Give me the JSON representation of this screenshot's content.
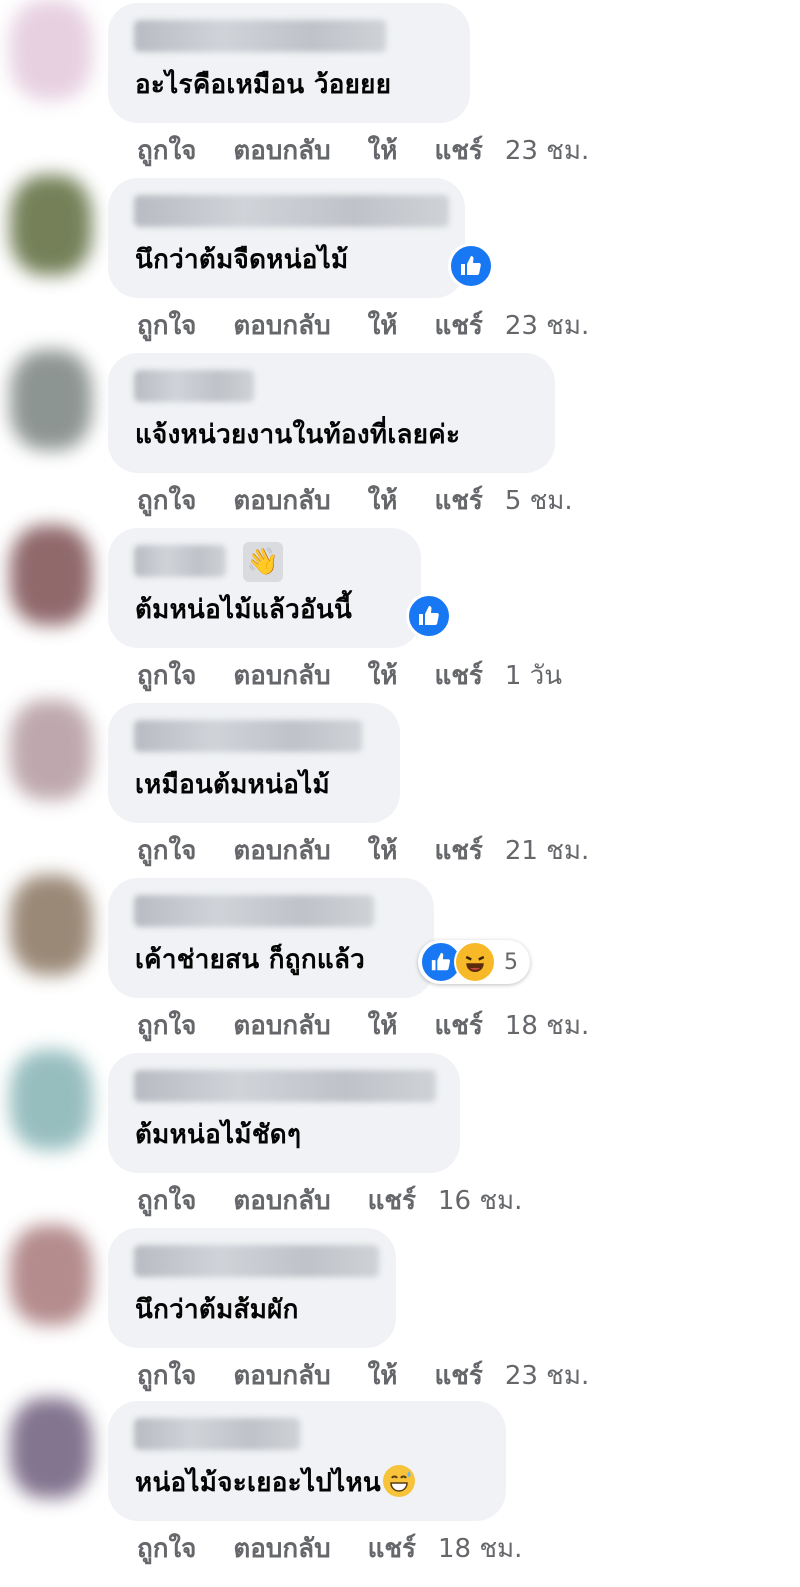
{
  "comments": [
    {
      "text": "อะไรคือเหมือน ว้อยยย",
      "actions": [
        "ถูกใจ",
        "ตอบกลับ",
        "ให้",
        "แชร์"
      ],
      "time": "23 ชม.",
      "avatar_color": "#e3c9dc"
    },
    {
      "text": "นึกว่าต้มจืดหน่อไม้",
      "actions": [
        "ถูกใจ",
        "ตอบกลับ",
        "ให้",
        "แชร์"
      ],
      "time": "23 ชม.",
      "avatar_color": "#5d6b3c",
      "reaction": "like"
    },
    {
      "text": "แจ้งหน่วยงานในท้องที่เลยค่ะ",
      "actions": [
        "ถูกใจ",
        "ตอบกลับ",
        "ให้",
        "แชร์"
      ],
      "time": "5 ชม.",
      "avatar_color": "#7a837f"
    },
    {
      "text": "ต้มหน่อไม้แล้วอันนี้",
      "actions": [
        "ถูกใจ",
        "ตอบกลับ",
        "ให้",
        "แชร์"
      ],
      "time": "1 วัน",
      "avatar_color": "#7d4f52",
      "reaction": "like",
      "name_badge": "👋"
    },
    {
      "text": "เหมือนต้มหน่อไม้",
      "actions": [
        "ถูกใจ",
        "ตอบกลับ",
        "ให้",
        "แชร์"
      ],
      "time": "21 ชม.",
      "avatar_color": "#b39aa0"
    },
    {
      "text": "เค้าช่ายสน ก็ถูกแล้ว",
      "actions": [
        "ถูกใจ",
        "ตอบกลับ",
        "ให้",
        "แชร์"
      ],
      "time": "18 ชม.",
      "avatar_color": "#8a7560",
      "reaction_group": {
        "types": [
          "like",
          "haha"
        ],
        "count": "5"
      }
    },
    {
      "text": "ต้มหน่อไม้ชัดๆ",
      "actions": [
        "ถูกใจ",
        "ตอบกลับ",
        "แชร์"
      ],
      "time": "16 ชม.",
      "avatar_color": "#86b3b5"
    },
    {
      "text": "นึกว่าต้มส้มผัก",
      "actions": [
        "ถูกใจ",
        "ตอบกลับ",
        "ให้",
        "แชร์"
      ],
      "time": "23 ชม.",
      "avatar_color": "#a8787a"
    },
    {
      "text": "หน่อไม้จะเยอะไปไหน",
      "actions": [
        "ถูกใจ",
        "ตอบกลับ",
        "แชร์"
      ],
      "time": "18 ชม.",
      "avatar_color": "#6e5d7c",
      "text_emoji": "sweat-smile-emoji"
    }
  ],
  "colors": {
    "bubble": "#f0f2f5",
    "muted_text": "#65676b",
    "like_blue": "#1877f2",
    "haha_yellow": "#f7b928"
  }
}
